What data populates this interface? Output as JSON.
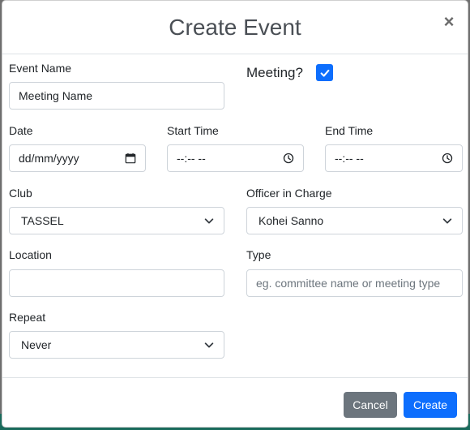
{
  "modal": {
    "title": "Create Event",
    "close_symbol": "×"
  },
  "form": {
    "event_name": {
      "label": "Event Name",
      "value": "Meeting Name"
    },
    "meeting": {
      "label": "Meeting?",
      "checked": true
    },
    "date": {
      "label": "Date",
      "value": "dd/mm/yyyy",
      "icon": "calendar-icon"
    },
    "start_time": {
      "label": "Start Time",
      "value": "--:-- --",
      "icon": "clock-icon"
    },
    "end_time": {
      "label": "End Time",
      "value": "--:-- --",
      "icon": "clock-icon"
    },
    "club": {
      "label": "Club",
      "value": "TASSEL"
    },
    "officer": {
      "label": "Officer in Charge",
      "value": "Kohei Sanno"
    },
    "location": {
      "label": "Location",
      "value": ""
    },
    "type": {
      "label": "Type",
      "placeholder": "eg. committee name or meeting type"
    },
    "repeat": {
      "label": "Repeat",
      "value": "Never"
    }
  },
  "footer": {
    "cancel_label": "Cancel",
    "create_label": "Create"
  },
  "colors": {
    "primary": "#0d6efd",
    "secondary": "#6c757d",
    "backdrop_accent": "#1a6b5c"
  }
}
